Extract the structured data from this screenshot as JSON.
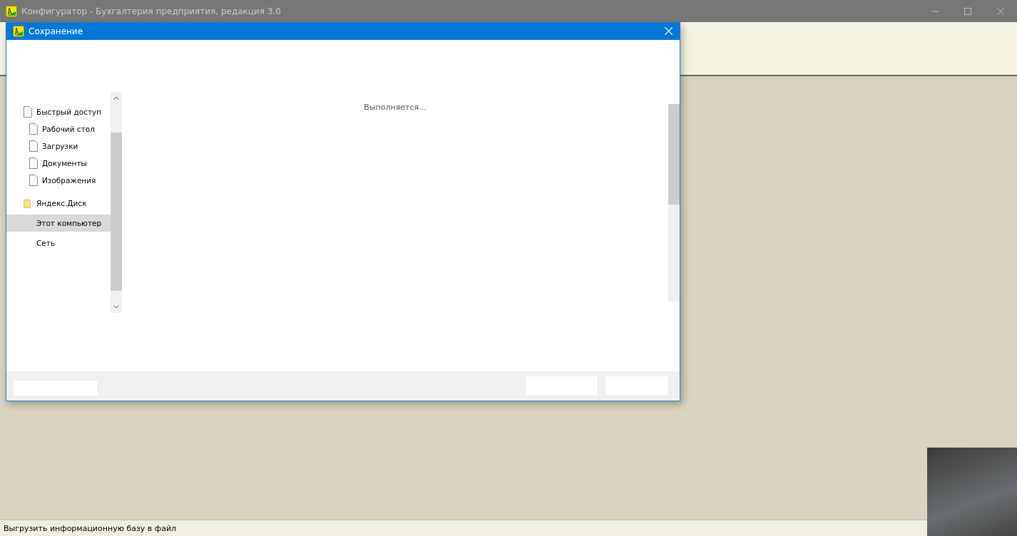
{
  "window": {
    "title": "Конфигуратор - Бухгалтерия предприятия, редакция 3.0"
  },
  "dialog": {
    "title": "Сохранение",
    "progress_text": "Выполняется...",
    "nav_tree": [
      {
        "label": "Быстрый доступ",
        "kind": "file",
        "selected": false,
        "children": [
          {
            "label": "Рабочий стол",
            "kind": "file",
            "selected": false
          },
          {
            "label": "Загрузки",
            "kind": "file",
            "selected": false
          },
          {
            "label": "Документы",
            "kind": "file",
            "selected": false
          },
          {
            "label": "Изображения",
            "kind": "file",
            "selected": false
          }
        ]
      },
      {
        "label": "Яндекс.Диск",
        "kind": "folder",
        "selected": false
      },
      {
        "label": "Этот компьютер",
        "kind": "none",
        "selected": true
      },
      {
        "label": "Сеть",
        "kind": "none",
        "selected": false
      }
    ]
  },
  "status_bar": {
    "text": "Выгрузить информационную базу в файл"
  }
}
